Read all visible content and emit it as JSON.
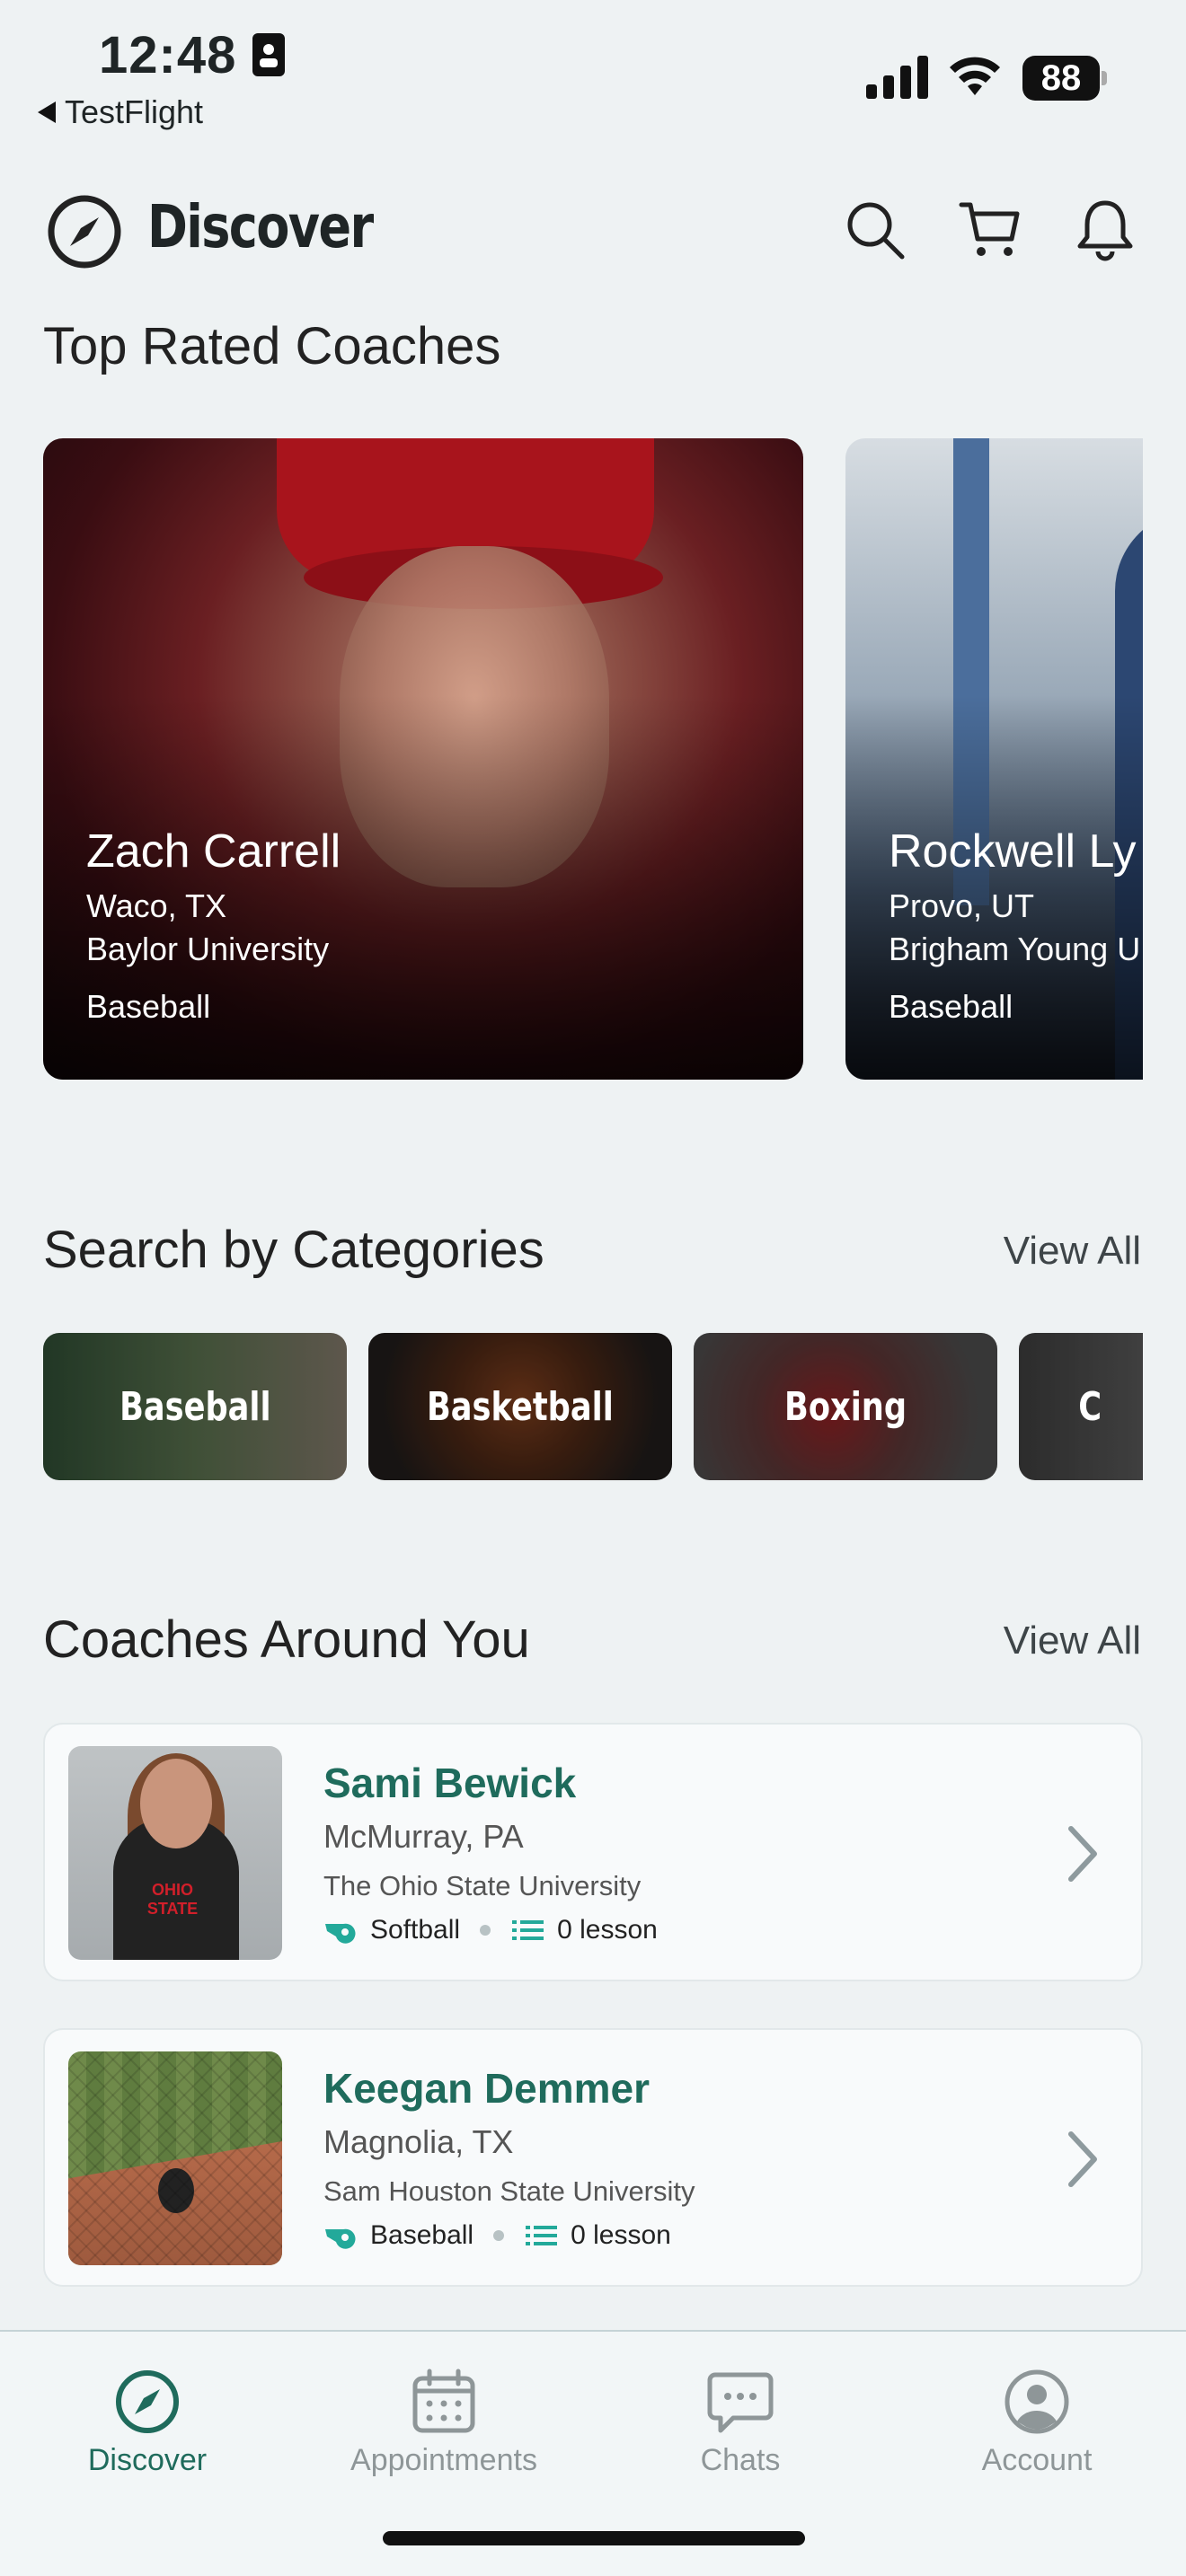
{
  "status": {
    "time": "12:48",
    "back_app": "TestFlight",
    "battery": "88"
  },
  "header": {
    "title": "Discover"
  },
  "top_rated": {
    "title": "Top Rated Coaches",
    "coaches": [
      {
        "name": "Zach Carrell",
        "location": "Waco, TX",
        "school": "Baylor University",
        "sport": "Baseball"
      },
      {
        "name": "Rockwell Ly",
        "location": "Provo, UT",
        "school": "Brigham Young U",
        "sport": "Baseball"
      }
    ]
  },
  "categories": {
    "title": "Search by Categories",
    "view_all": "View All",
    "items": [
      {
        "label": "Baseball"
      },
      {
        "label": "Basketball"
      },
      {
        "label": "Boxing"
      },
      {
        "label": "C"
      }
    ]
  },
  "nearby": {
    "title": "Coaches Around You",
    "view_all": "View All",
    "coaches": [
      {
        "name": "Sami Bewick",
        "location": "McMurray, PA",
        "school": "The Ohio State University",
        "sport": "Softball",
        "lessons": "0 lesson",
        "photo_text": "OHIO STATE"
      },
      {
        "name": "Keegan Demmer",
        "location": "Magnolia, TX",
        "school": "Sam Houston State University",
        "sport": "Baseball",
        "lessons": "0 lesson"
      }
    ]
  },
  "tabs": [
    {
      "label": "Discover",
      "active": true
    },
    {
      "label": "Appointments",
      "active": false
    },
    {
      "label": "Chats",
      "active": false
    },
    {
      "label": "Account",
      "active": false
    }
  ],
  "colors": {
    "accent": "#1f6b5c",
    "teal_icon": "#23a99a",
    "background": "#eef2f3"
  }
}
